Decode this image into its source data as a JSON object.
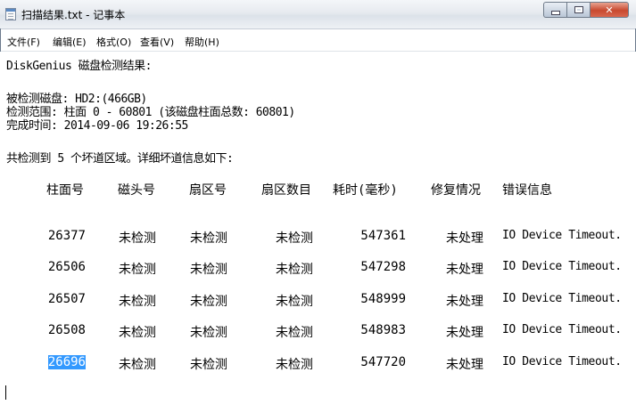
{
  "window": {
    "title": "扫描结果.txt - 记事本",
    "buttons": {
      "minimize": "minimize",
      "maximize": "maximize",
      "close": "close"
    }
  },
  "menu": [
    "文件(F)",
    "编辑(E)",
    "格式(O)",
    "查看(V)",
    "帮助(H)"
  ],
  "document": {
    "heading": "DiskGenius 磁盘检测结果:",
    "disk_line": "被检测磁盘: HD2:(466GB)",
    "range_line": "检测范围: 柱面 0 - 60801 (该磁盘柱面总数: 60801)",
    "time_line": "完成时间: 2014-09-06 19:26:55",
    "summary_line": "共检测到 5 个坏道区域。详细坏道信息如下:",
    "columns": [
      "柱面号",
      "磁头号",
      "扇区号",
      "扇区数目",
      "耗时(毫秒)",
      "修复情况",
      "错误信息"
    ],
    "rows": [
      [
        "26377",
        "未检测",
        "未检测",
        "未检测",
        "547361",
        "未处理",
        "IO Device Timeout."
      ],
      [
        "26506",
        "未检测",
        "未检测",
        "未检测",
        "547298",
        "未处理",
        "IO Device Timeout."
      ],
      [
        "26507",
        "未检测",
        "未检测",
        "未检测",
        "548999",
        "未处理",
        "IO Device Timeout."
      ],
      [
        "26508",
        "未检测",
        "未检测",
        "未检测",
        "548983",
        "未处理",
        "IO Device Timeout."
      ],
      [
        "26696",
        "未检测",
        "未检测",
        "未检测",
        "547720",
        "未处理",
        "IO Device Timeout."
      ]
    ],
    "selected_text": "26696"
  },
  "colors": {
    "selection": "#3399ff",
    "close_button": "#c8492f"
  }
}
